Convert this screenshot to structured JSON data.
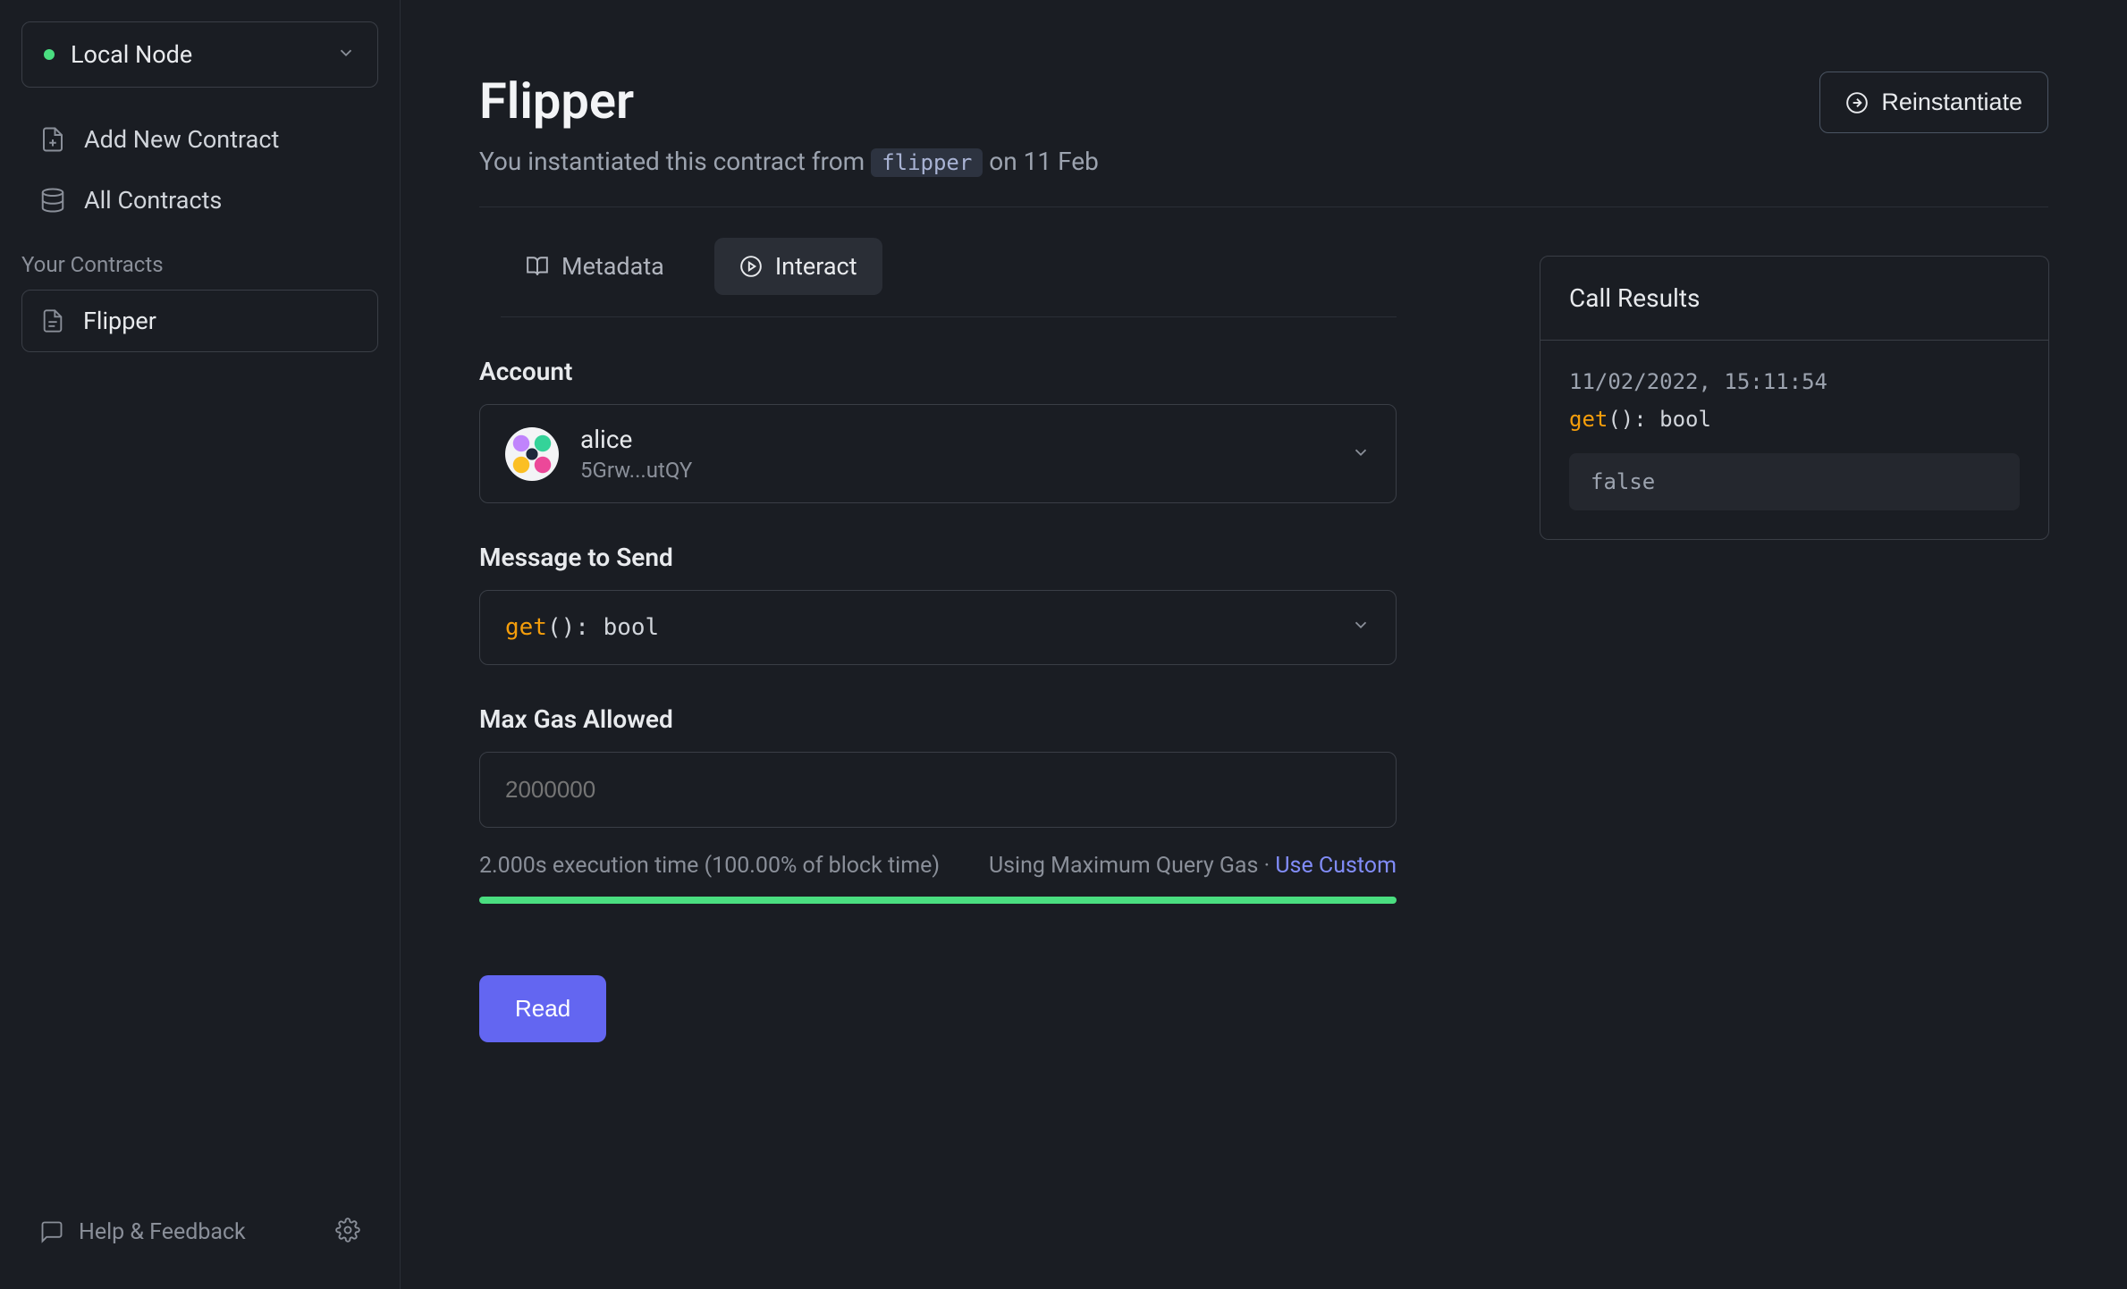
{
  "sidebar": {
    "node": "Local Node",
    "nav": {
      "add": "Add New Contract",
      "all": "All Contracts"
    },
    "section_title": "Your Contracts",
    "contracts": [
      "Flipper"
    ],
    "help": "Help & Feedback"
  },
  "header": {
    "title": "Flipper",
    "subtitle_prefix": "You instantiated this contract from ",
    "subtitle_code": "flipper",
    "subtitle_suffix": " on 11 Feb",
    "reinstantiate": "Reinstantiate"
  },
  "tabs": {
    "metadata": "Metadata",
    "interact": "Interact"
  },
  "form": {
    "account_label": "Account",
    "account": {
      "name": "alice",
      "addr": "5Grw...utQY"
    },
    "message_label": "Message to Send",
    "message_fn": "get",
    "message_sig": "(): bool",
    "gas_label": "Max Gas Allowed",
    "gas_placeholder": "2000000",
    "gas_exec": "2.000s execution time (100.00% of block time)",
    "gas_using": "Using Maximum Query Gas · ",
    "gas_link": "Use Custom",
    "read_button": "Read"
  },
  "results": {
    "title": "Call Results",
    "timestamp": "11/02/2022, 15:11:54",
    "fn": "get",
    "sig": "(): bool",
    "value": "false"
  }
}
